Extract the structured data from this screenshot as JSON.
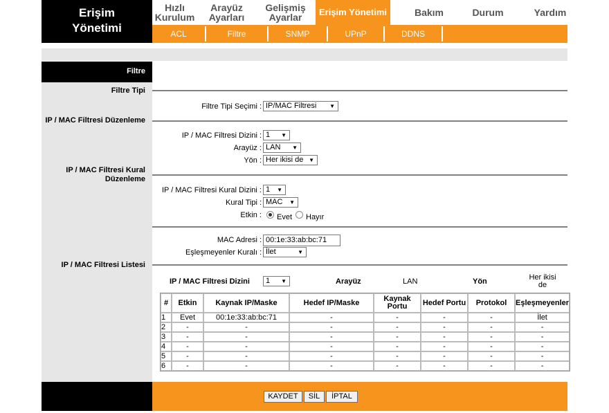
{
  "brand": {
    "line1": "Erişim",
    "line2": "Yönetimi"
  },
  "top_nav": [
    {
      "line1": "Hızlı",
      "line2": "Kurulum"
    },
    {
      "line1": "Arayüz",
      "line2": "Ayarları"
    },
    {
      "line1": "Gelişmiş",
      "line2": "Ayarlar"
    },
    {
      "line1": "Erişim Yönetimi",
      "line2": ""
    },
    {
      "line1": "Bakım",
      "line2": ""
    },
    {
      "line1": "Durum",
      "line2": ""
    },
    {
      "line1": "Yardım",
      "line2": ""
    }
  ],
  "sub_nav": [
    "ACL",
    "Filtre",
    "SNMP",
    "UPnP",
    "DDNS"
  ],
  "section_title": "Filtre",
  "sections": {
    "filter_type": "Filtre Tipi",
    "ip_mac_edit": "IP / MAC Filtresi Düzenleme",
    "rule_edit_line1": "IP / MAC Filtresi Kural",
    "rule_edit_line2": "Düzenleme",
    "list": "IP / MAC Filtresi Listesi"
  },
  "fields": {
    "filter_type_select_label": "Filtre Tipi Seçimi :",
    "filter_type_select_value": "IP/MAC Filtresi",
    "set_index_label": "IP / MAC Filtresi Dizini :",
    "set_index_value": "1",
    "interface_label": "Arayüz :",
    "interface_value": "LAN",
    "direction_label": "Yön :",
    "direction_value": "Her ikisi de",
    "rule_index_label": "IP / MAC Filtresi Kural Dizini :",
    "rule_index_value": "1",
    "rule_type_label": "Kural Tipi :",
    "rule_type_value": "MAC",
    "active_label": "Etkin :",
    "active_yes": "Evet",
    "active_no": "Hayır",
    "mac_label": "MAC Adresi :",
    "mac_value": "00:1e:33:ab:bc:71",
    "unmatched_label": "Eşleşmeyenler Kuralı :",
    "unmatched_value": "İlet"
  },
  "list_header": {
    "index_label": "IP / MAC Filtresi Dizini",
    "index_value": "1",
    "interface_label": "Arayüz",
    "interface_value": "LAN",
    "direction_label": "Yön",
    "direction_value_line1": "Her ikisi",
    "direction_value_line2": "de"
  },
  "table": {
    "columns": [
      "#",
      "Etkin",
      "Kaynak IP/Maske",
      "Hedef IP/Maske",
      "Kaynak Portu",
      "Hedef Portu",
      "Protokol",
      "Eşleşmeyenler"
    ],
    "rows": [
      [
        "1",
        "Evet",
        "00:1e:33:ab:bc:71",
        "-",
        "-",
        "-",
        "-",
        "İlet"
      ],
      [
        "2",
        "-",
        "-",
        "-",
        "-",
        "-",
        "-",
        "-"
      ],
      [
        "3",
        "-",
        "-",
        "-",
        "-",
        "-",
        "-",
        "-"
      ],
      [
        "4",
        "-",
        "-",
        "-",
        "-",
        "-",
        "-",
        "-"
      ],
      [
        "5",
        "-",
        "-",
        "-",
        "-",
        "-",
        "-",
        "-"
      ],
      [
        "6",
        "-",
        "-",
        "-",
        "-",
        "-",
        "-",
        "-"
      ]
    ]
  },
  "buttons": {
    "save": "KAYDET",
    "delete": "SİL",
    "cancel": "İPTAL"
  },
  "colors": {
    "accent": "#f7941d",
    "dark": "#000000",
    "panel": "#e6e6e6"
  }
}
